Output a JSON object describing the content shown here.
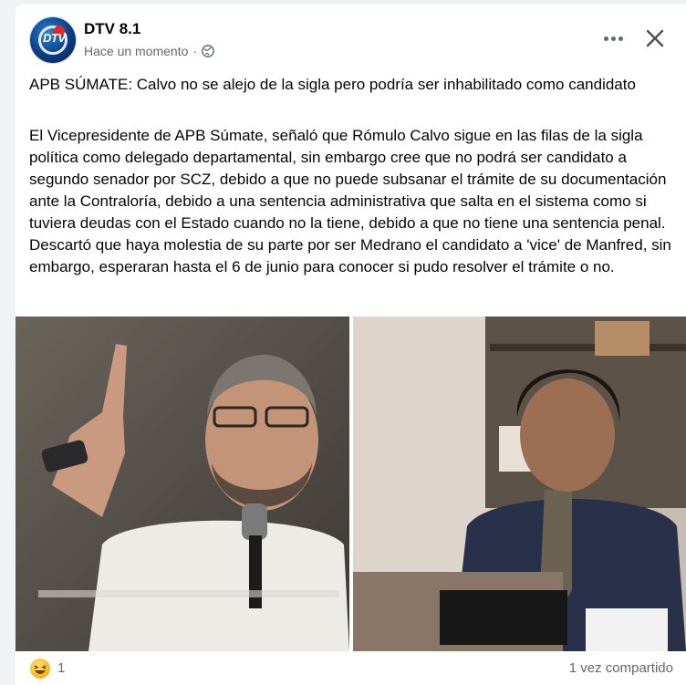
{
  "post": {
    "page_name": "DTV 8.1",
    "timestamp": "Hace un momento",
    "separator": "·",
    "avatar_text": "DTV",
    "title": "APB SÚMATE: Calvo no se alejo de la sigla pero podría ser inhabilitado como candidato",
    "body": "El Vicepresidente de APB Súmate, señaló que Rómulo Calvo sigue en las filas de la sigla política como delegado departamental, sin embargo cree que no podrá ser candidato a segundo senador por SCZ, debido a que no puede subsanar el trámite de su documentación ante la Contraloría, debido a una sentencia administrativa que salta en el sistema como si tuviera deudas con el Estado cuando no la tiene, debido a que no tiene una sentencia penal. Descartó que haya molestia de su parte por ser Medrano el candidato a 'vice' de Manfred, sin embargo, esperaran hasta el 6 de junio para conocer si pudo resolver el trámite o no."
  },
  "icons": {
    "privacy": "globe-icon",
    "more": "more-options-icon",
    "close": "close-icon",
    "reaction": "haha-reaction-icon"
  },
  "footer": {
    "reaction_count": "1",
    "shares": "1 vez compartido"
  },
  "colors": {
    "background": "#f0f2f5",
    "card": "#ffffff",
    "secondary_text": "#65676b",
    "avatar_blue": "#0b3c86",
    "avatar_red": "#e22a2a"
  }
}
